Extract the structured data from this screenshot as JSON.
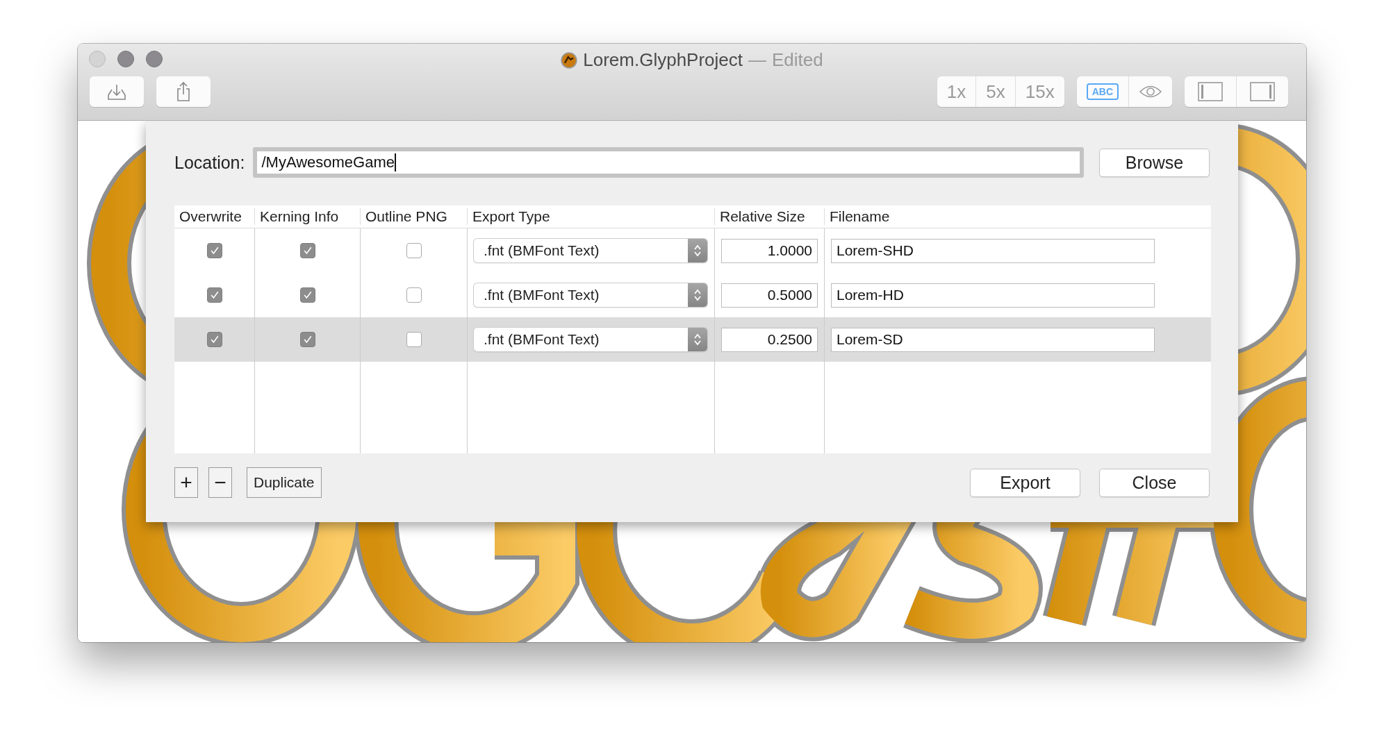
{
  "window": {
    "title": "Lorem.GlyphProject",
    "separator": "—",
    "status": "Edited"
  },
  "toolbar": {
    "zoom_levels": [
      {
        "label": "1x",
        "selected": false
      },
      {
        "label": "5x",
        "selected": false
      },
      {
        "label": "15x",
        "selected": false
      }
    ],
    "text_toggle": {
      "label": "ABC",
      "on": true
    }
  },
  "canvas": {
    "kind": "glyph_preview"
  },
  "export_sheet": {
    "location": {
      "label": "Location:",
      "value": "/MyAwesomeGame"
    },
    "browse": "Browse",
    "columns": [
      "Overwrite",
      "Kerning Info",
      "Outline PNG",
      "Export Type",
      "Relative Size",
      "Filename"
    ],
    "rows": [
      {
        "overwrite": true,
        "kerning_info": true,
        "outline_png": false,
        "export_type": ".fnt (BMFont Text)",
        "relative_size": "1.0000",
        "filename": "Lorem-SHD",
        "selected": false
      },
      {
        "overwrite": true,
        "kerning_info": true,
        "outline_png": false,
        "export_type": ".fnt (BMFont Text)",
        "relative_size": "0.5000",
        "filename": "Lorem-HD",
        "selected": false
      },
      {
        "overwrite": true,
        "kerning_info": true,
        "outline_png": false,
        "export_type": ".fnt (BMFont Text)",
        "relative_size": "0.2500",
        "filename": "Lorem-SD",
        "selected": true
      }
    ],
    "add": "+",
    "remove": "−",
    "duplicate": "Duplicate",
    "export": "Export",
    "close": "Close"
  }
}
